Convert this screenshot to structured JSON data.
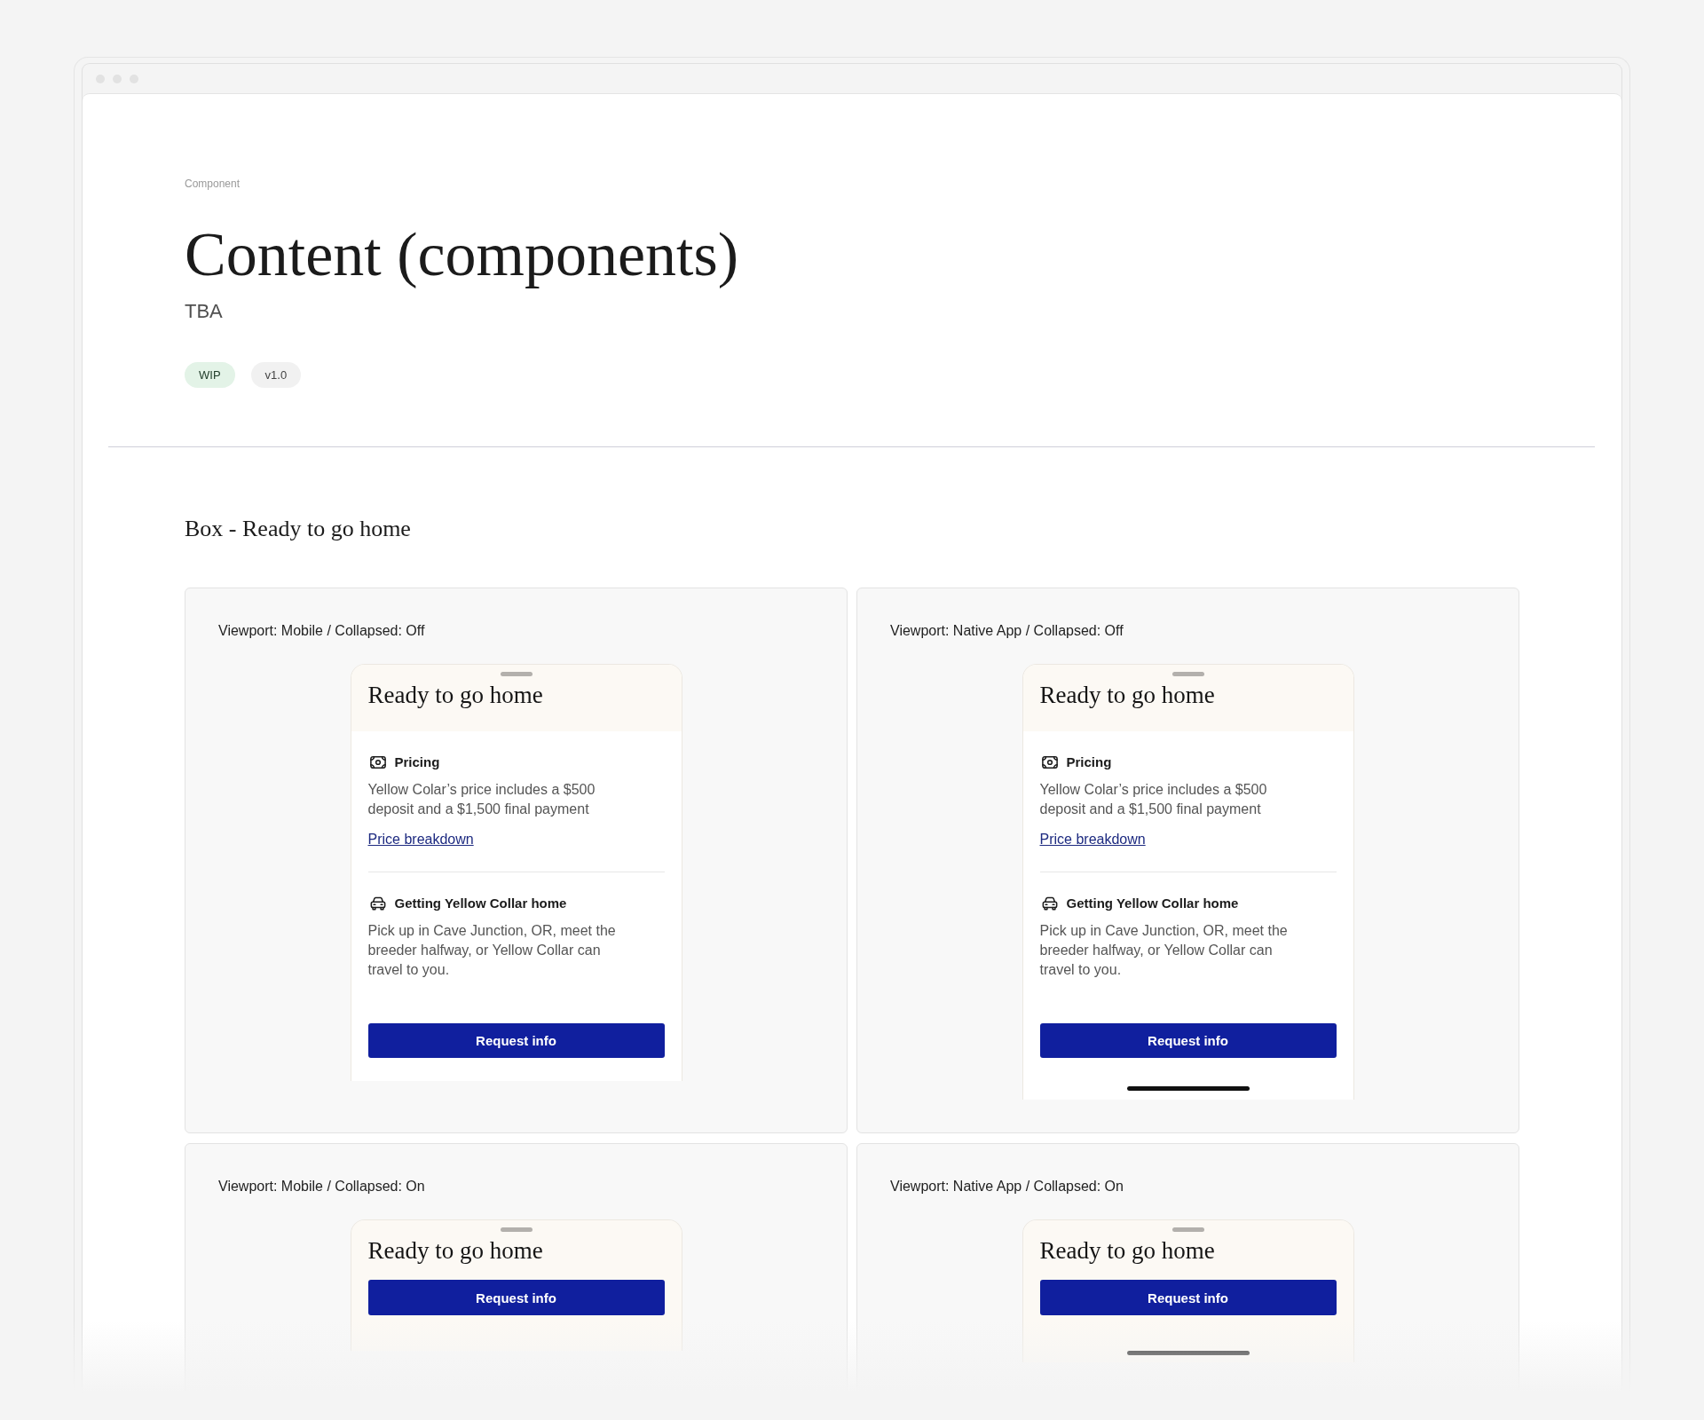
{
  "header": {
    "eyebrow": "Component",
    "title": "Content (components)",
    "subtitle": "TBA",
    "tags": [
      {
        "label": "WIP",
        "kind": "status"
      },
      {
        "label": "v1.0",
        "kind": "version"
      }
    ]
  },
  "section": {
    "title": "Box - Ready to go home",
    "examples": [
      {
        "label": "Viewport: Mobile / Collapsed: Off",
        "kind": "mobile",
        "collapsed": false,
        "sheet": {
          "title": "Ready to go home",
          "blocks": [
            {
              "heading": "Pricing",
              "body": "Yellow Colar’s price includes a $500 deposit and a $1,500 final payment",
              "link": "Price breakdown"
            },
            {
              "heading": "Getting Yellow Collar home",
              "body": "Pick up in Cave Junction, OR, meet the breeder halfway, or Yellow Collar can travel to you."
            }
          ],
          "button": "Request info"
        }
      },
      {
        "label": "Viewport: Native App / Collapsed: Off",
        "kind": "native_app",
        "collapsed": false,
        "sheet": {
          "title": "Ready to go home",
          "blocks": [
            {
              "heading": "Pricing",
              "body": "Yellow Colar’s price includes a $500 deposit and a $1,500 final payment",
              "link": "Price breakdown"
            },
            {
              "heading": "Getting Yellow Collar home",
              "body": "Pick up in Cave Junction, OR, meet the breeder halfway, or Yellow Collar can travel to you."
            }
          ],
          "button": "Request info"
        }
      },
      {
        "label": "Viewport: Mobile / Collapsed: On",
        "kind": "mobile",
        "collapsed": true,
        "sheet": {
          "title": "Ready to go home",
          "button": "Request info"
        }
      },
      {
        "label": "Viewport: Native App / Collapsed: On",
        "kind": "native_app",
        "collapsed": true,
        "sheet": {
          "title": "Ready to go home",
          "button": "Request info"
        }
      }
    ]
  }
}
